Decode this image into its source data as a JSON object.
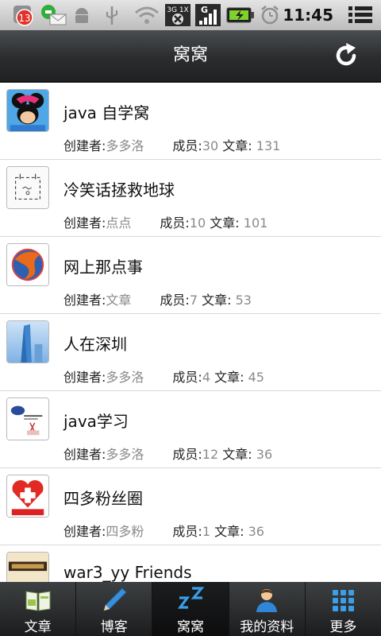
{
  "status_bar": {
    "notification_count": "13",
    "network_label": "3G 1X",
    "signal_label": "G",
    "time": "11:45"
  },
  "header": {
    "title": "窝窝"
  },
  "list_labels": {
    "creator": "创建者:",
    "members": "成员:",
    "articles": "文章:"
  },
  "items": [
    {
      "name": "java 自学窝",
      "creator": "多多洛",
      "members": "30",
      "articles": "131"
    },
    {
      "name": "冷笑话拯救地球",
      "creator": "点点",
      "members": "10",
      "articles": "101"
    },
    {
      "name": "网上那点事",
      "creator": "文章",
      "members": "7",
      "articles": "53"
    },
    {
      "name": "人在深圳",
      "creator": "多多洛",
      "members": "4",
      "articles": "45"
    },
    {
      "name": "java学习",
      "creator": "多多洛",
      "members": "12",
      "articles": "36"
    },
    {
      "name": "四多粉丝圈",
      "creator": "四多粉",
      "members": "1",
      "articles": "36"
    },
    {
      "name": "war3_yy Friends",
      "creator": "",
      "members": "",
      "articles": ""
    }
  ],
  "tabs": [
    {
      "label": "文章"
    },
    {
      "label": "博客"
    },
    {
      "label": "窝窝"
    },
    {
      "label": "我的资料"
    },
    {
      "label": "更多"
    }
  ]
}
